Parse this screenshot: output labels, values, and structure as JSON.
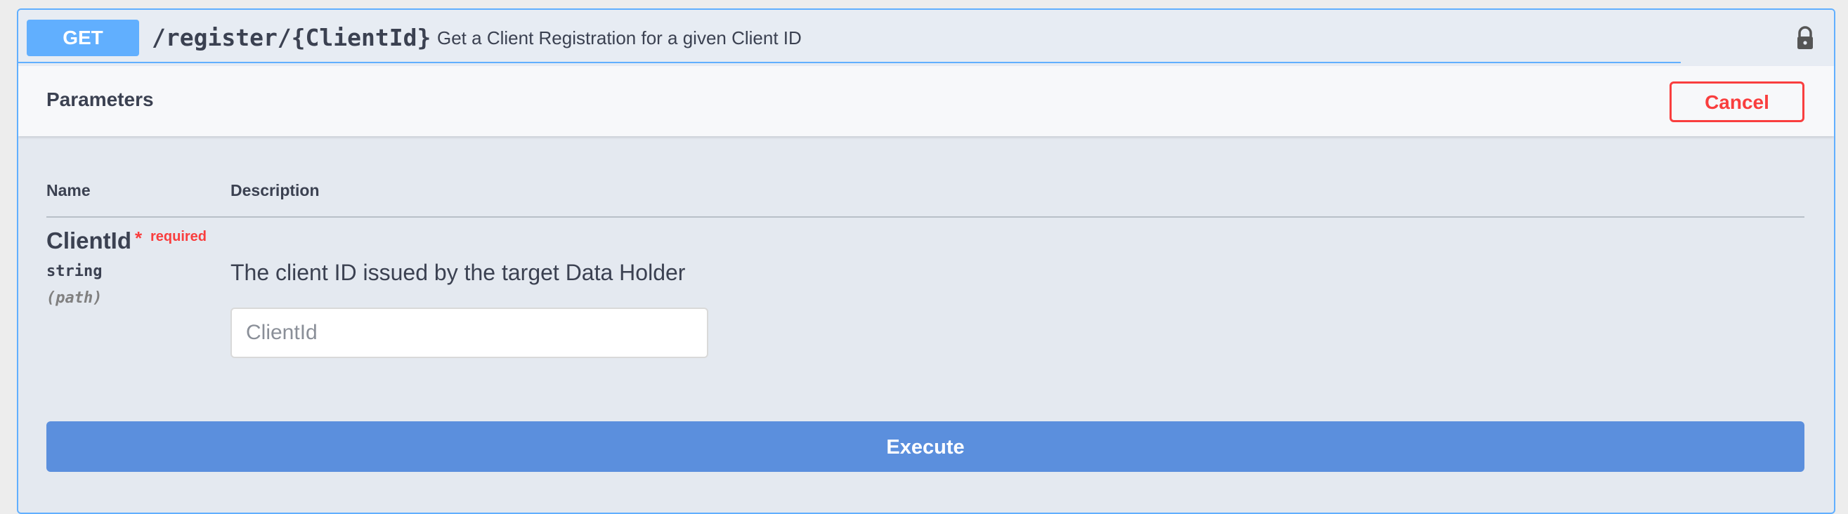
{
  "operation": {
    "method": "GET",
    "path": "/register/{ClientId}",
    "summary": "Get a Client Registration for a given Client ID",
    "lock_icon": "lock-icon"
  },
  "parameters": {
    "title": "Parameters",
    "cancel_label": "Cancel",
    "columns": {
      "name": "Name",
      "description": "Description"
    },
    "items": [
      {
        "name": "ClientId",
        "required_marker": "*",
        "required_label": "required",
        "type": "string",
        "in": "(path)",
        "description": "The client ID issued by the target Data Holder",
        "value": "",
        "placeholder": "ClientId"
      }
    ]
  },
  "execute_label": "Execute",
  "colors": {
    "method_get": "#61affe",
    "cancel": "#f93e3e",
    "execute": "#5b8fdd",
    "text": "#3b4151"
  }
}
